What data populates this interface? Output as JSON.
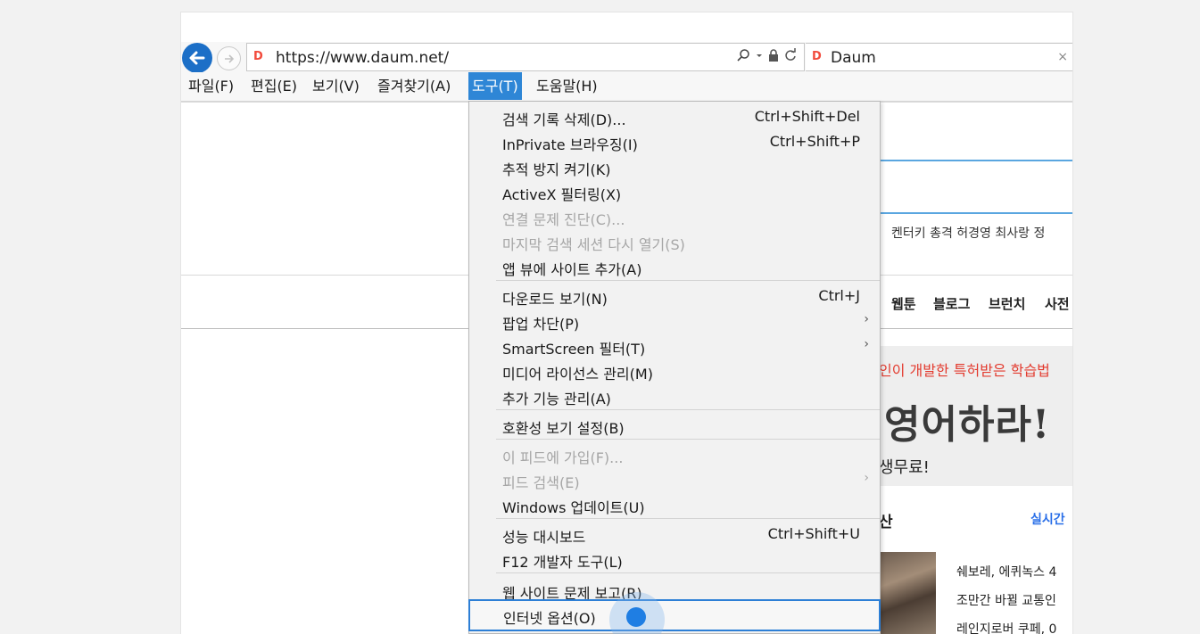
{
  "browser": {
    "url": "https://www.daum.net/",
    "tab_title": "Daum",
    "tab_close": "×",
    "url_tools": [
      "search-icon",
      "dropdown-icon",
      "lock-icon",
      "refresh-icon"
    ],
    "accent": "#1c6fc7"
  },
  "menubar": {
    "items": [
      "파일(F)",
      "편집(E)",
      "보기(V)",
      "즐겨찾기(A)",
      "도구(T)",
      "도움말(H)"
    ],
    "active": "도구(T)"
  },
  "tools_menu": {
    "items": [
      {
        "label": "검색 기록 삭제(D)...",
        "shortcut": "Ctrl+Shift+Del"
      },
      {
        "label": "InPrivate 브라우징(I)",
        "shortcut": "Ctrl+Shift+P"
      },
      {
        "label": "추적 방지 켜기(K)"
      },
      {
        "label": "ActiveX 필터링(X)"
      },
      {
        "label": "연결 문제 진단(C)...",
        "disabled": true
      },
      {
        "label": "마지막 검색 세션 다시 열기(S)",
        "disabled": true
      },
      {
        "label": "앱 뷰에 사이트 추가(A)"
      },
      {
        "label": "다운로드 보기(N)",
        "shortcut": "Ctrl+J"
      },
      {
        "label": "팝업 차단(P)",
        "submenu": "›"
      },
      {
        "label": "SmartScreen 필터(T)",
        "submenu": "›"
      },
      {
        "label": "미디어 라이선스 관리(M)"
      },
      {
        "label": "추가 기능 관리(A)"
      },
      {
        "label": "호환성 보기 설정(B)"
      },
      {
        "label": "이 피드에 가입(F)...",
        "disabled": true
      },
      {
        "label": "피드 검색(E)",
        "disabled": true,
        "submenu": "›"
      },
      {
        "label": "Windows 업데이트(U)"
      },
      {
        "label": "성능 대시보드",
        "shortcut": "Ctrl+Shift+U"
      },
      {
        "label": "F12 개발자 도구(L)"
      },
      {
        "label": "웹 사이트 문제 보고(R)"
      },
      {
        "label": "인터넷 옵션(O)",
        "highlighted": true
      }
    ]
  },
  "page": {
    "issues": "켄터키 총격  허경영 최사랑  정",
    "nav": [
      "웹툰",
      "블로그",
      "브런치",
      "사전"
    ],
    "ad": {
      "headline": "인이 개발한 특허받은 학습법",
      "big_text": "영어하라!",
      "sub": "생무료!"
    },
    "section_title": "산",
    "section_link": "실시간",
    "news": [
      "쉐보레, 에퀴녹스 4",
      "조만간 바뀔 교통인",
      "레인지로버 쿠페, 0"
    ]
  }
}
